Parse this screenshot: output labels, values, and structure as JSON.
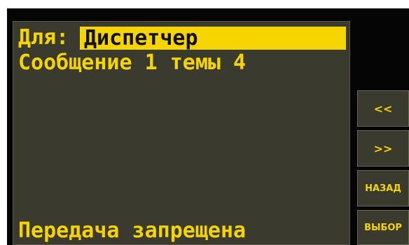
{
  "message": {
    "to_label": "Для:",
    "to_value": "Диспетчер",
    "subject": "Сообщение 1 темы 4",
    "status": "Передача запрещена"
  },
  "softkeys": {
    "prev_label": "<<",
    "next_label": ">>",
    "back_label": "НАЗАД",
    "select_label": "ВЫБОР"
  },
  "colors": {
    "text": "#f5d400",
    "panel": "#3b3a2f",
    "bezel": "#050505",
    "highlight_text": "#111111"
  }
}
